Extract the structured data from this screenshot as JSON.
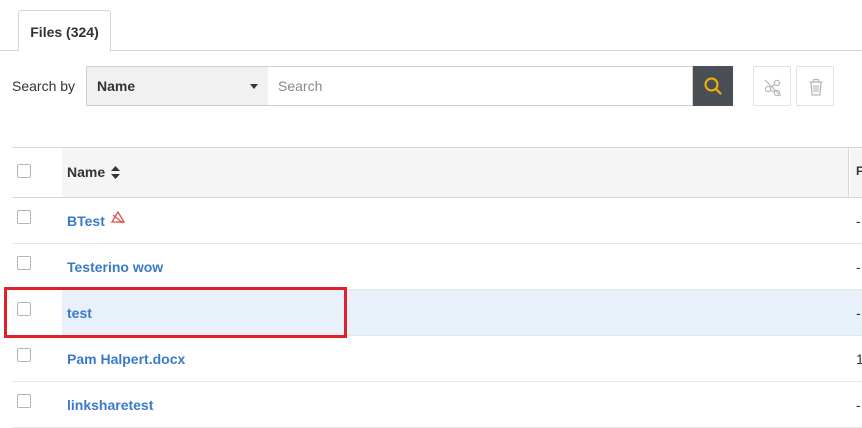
{
  "tabs": [
    {
      "label": "Files (324)",
      "active": true
    }
  ],
  "search": {
    "label": "Search by",
    "field_selected": "Name",
    "placeholder": "Search",
    "value": ""
  },
  "table": {
    "header": {
      "name": "Name",
      "next_col_partial": "F"
    },
    "rows": [
      {
        "name": "BTest",
        "has_warning_icon": true,
        "next_col_partial": "-"
      },
      {
        "name": "Testerino wow",
        "next_col_partial": "-"
      },
      {
        "name": "test",
        "next_col_partial": "-",
        "highlighted": true
      },
      {
        "name": "Pam Halpert.docx",
        "next_col_partial": "1"
      },
      {
        "name": "linksharetest",
        "next_col_partial": "-"
      }
    ]
  },
  "colors": {
    "link": "#3a7bc8",
    "search_button": "#4a4f55",
    "search_icon": "#f2b400",
    "highlight_row": "#e8f0fa",
    "annotation_box": "#e0202a",
    "warning_icon": "#d9534f"
  },
  "icons": {
    "search": "search-icon",
    "share": "unshare-icon",
    "delete": "trash-icon",
    "sort": "sort-icon",
    "warning": "warning-icon"
  }
}
